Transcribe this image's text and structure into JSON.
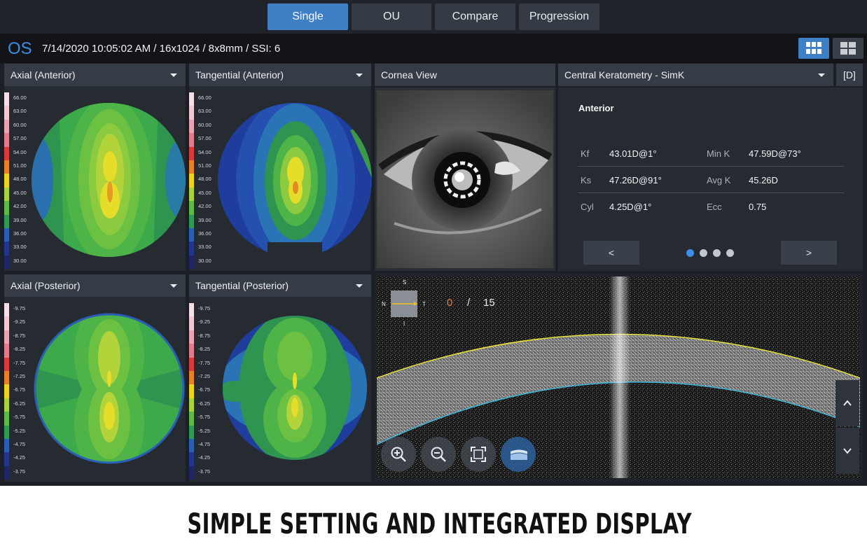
{
  "tabs": [
    {
      "label": "Single",
      "active": true
    },
    {
      "label": "OU",
      "active": false
    },
    {
      "label": "Compare",
      "active": false
    },
    {
      "label": "Progression",
      "active": false
    }
  ],
  "exam": {
    "eye": "OS",
    "info": "7/14/2020 10:05:02 AM / 16x1024 / 8x8mm / SSI: 6"
  },
  "layout_buttons": [
    {
      "icon": "grid-3x2-icon",
      "active": true
    },
    {
      "icon": "grid-2x2-icon",
      "active": false
    }
  ],
  "maps": {
    "axial_anterior": {
      "title": "Axial (Anterior)"
    },
    "tangential_anterior": {
      "title": "Tangential (Anterior)"
    },
    "axial_posterior": {
      "title": "Axial (Posterior)"
    },
    "tangential_posterior": {
      "title": "Tangential (Posterior)"
    }
  },
  "scales": {
    "anterior": [
      "66.00",
      "63.00",
      "60.00",
      "57.00",
      "54.00",
      "51.00",
      "48.00",
      "45.00",
      "42.00",
      "39.00",
      "36.00",
      "33.00",
      "30.00"
    ],
    "posterior": [
      "-9.75",
      "-9.25",
      "-8.75",
      "-8.25",
      "-7.75",
      "-7.25",
      "-6.75",
      "-6.25",
      "-5.75",
      "-5.25",
      "-4.75",
      "-4.25",
      "-3.75"
    ],
    "colors": [
      "#f6dfe6",
      "#f2c8d2",
      "#eca4b4",
      "#e47c8d",
      "#dc3a3a",
      "#ea8025",
      "#efd21c",
      "#a9d23f",
      "#5dba45",
      "#2f9a55",
      "#2a5fb6",
      "#23368f",
      "#1d2468"
    ]
  },
  "cornea_view": {
    "title": "Cornea View"
  },
  "keratometry": {
    "title": "Central Keratometry - SimK",
    "unit": "[D]",
    "section": "Anterior",
    "rows": [
      {
        "l1": "Kf",
        "v1": "43.01D@1°",
        "l2": "Min K",
        "v2": "47.59D@73°"
      },
      {
        "l1": "Ks",
        "v1": "47.26D@91°",
        "l2": "Avg K",
        "v2": "45.26D"
      },
      {
        "l1": "Cyl",
        "v1": "4.25D@1°",
        "l2": "Ecc",
        "v2": "0.75"
      }
    ],
    "prev": "<",
    "next": ">",
    "pages": 4,
    "active_page": 0
  },
  "oct": {
    "slice_current": "0",
    "slice_sep": "/",
    "slice_total": "15",
    "orientation": {
      "s": "S",
      "n": "N",
      "t": "T",
      "i": "I"
    }
  },
  "caption": "SIMPLE SETTING AND INTEGRATED DISPLAY"
}
